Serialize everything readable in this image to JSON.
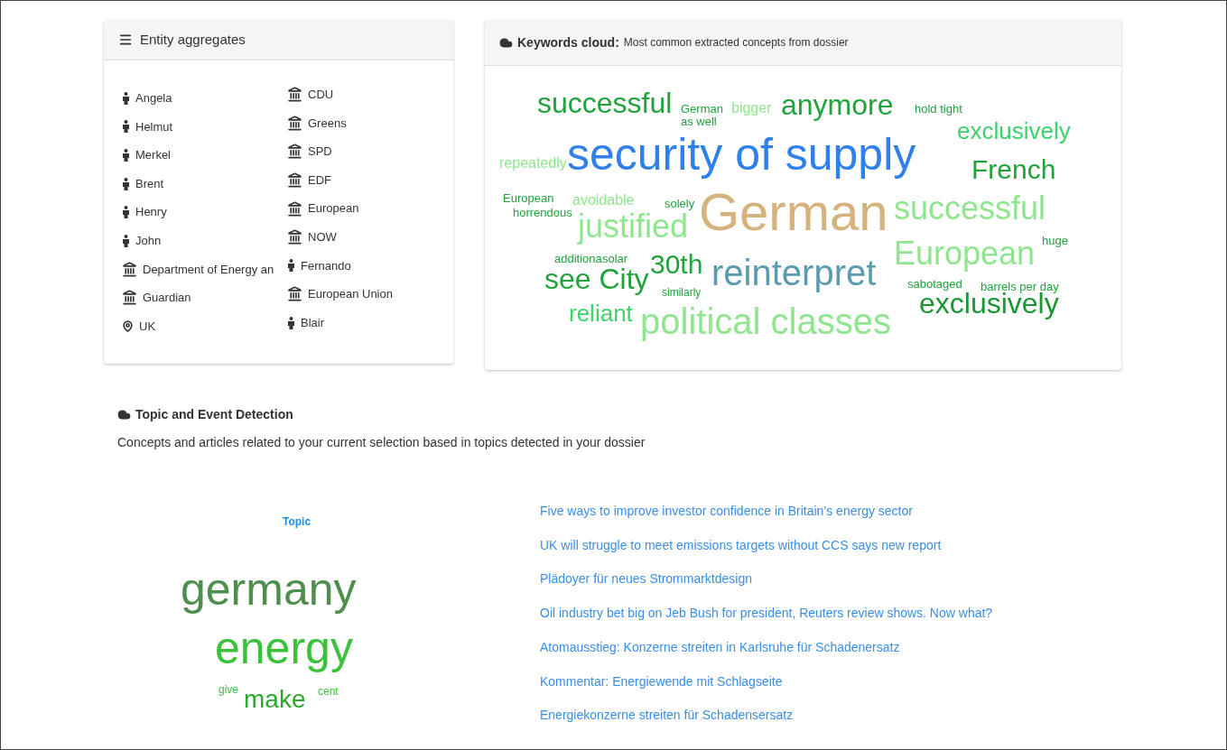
{
  "entity_panel": {
    "title": "Entity aggregates",
    "columns": [
      [
        {
          "kind": "person",
          "name": "Angela"
        },
        {
          "kind": "person",
          "name": "Helmut"
        },
        {
          "kind": "person",
          "name": "Merkel"
        },
        {
          "kind": "person",
          "name": "Brent"
        },
        {
          "kind": "person",
          "name": "Henry"
        },
        {
          "kind": "person",
          "name": "John"
        },
        {
          "kind": "organization",
          "name": "Department of Energy an"
        },
        {
          "kind": "organization",
          "name": "Guardian"
        },
        {
          "kind": "place",
          "name": "UK"
        }
      ],
      [
        {
          "kind": "organization",
          "name": "CDU"
        },
        {
          "kind": "organization",
          "name": "Greens"
        },
        {
          "kind": "organization",
          "name": "SPD"
        },
        {
          "kind": "organization",
          "name": "EDF"
        },
        {
          "kind": "organization",
          "name": "European"
        },
        {
          "kind": "organization",
          "name": "NOW"
        },
        {
          "kind": "person",
          "name": "Fernando"
        },
        {
          "kind": "organization",
          "name": "European Union"
        },
        {
          "kind": "person",
          "name": "Blair"
        }
      ]
    ]
  },
  "keywords_panel": {
    "title": "Keywords cloud:",
    "subtitle": "Most common extracted concepts from dossier",
    "words": [
      {
        "text": "successful",
        "color": "#1fa33a"
      },
      {
        "text": "German",
        "color": "#1fa33a"
      },
      {
        "text": "as well",
        "color": "#1fa33a"
      },
      {
        "text": "bigger",
        "color": "#8fe68f"
      },
      {
        "text": "anymore",
        "color": "#1fa33a"
      },
      {
        "text": "hold tight",
        "color": "#1fa33a"
      },
      {
        "text": "exclusively",
        "color": "#3fd16a"
      },
      {
        "text": "repeatedly",
        "color": "#8fe68f"
      },
      {
        "text": "security of supply",
        "color": "#2f80ed"
      },
      {
        "text": "French",
        "color": "#1fa33a"
      },
      {
        "text": "European",
        "color": "#1fa33a"
      },
      {
        "text": "horrendous",
        "color": "#1fa33a"
      },
      {
        "text": "avoidable",
        "color": "#8fe68f"
      },
      {
        "text": "solely",
        "color": "#1fa33a"
      },
      {
        "text": "German",
        "color": "#d6b27c"
      },
      {
        "text": "successful",
        "color": "#8fe68f"
      },
      {
        "text": "justified",
        "color": "#8fe68f"
      },
      {
        "text": "huge",
        "color": "#1fa33a"
      },
      {
        "text": "additiona",
        "color": "#1fa33a"
      },
      {
        "text": "solar",
        "color": "#1fa33a"
      },
      {
        "text": "30th",
        "color": "#1fa33a"
      },
      {
        "text": "reinterpret",
        "color": "#5b9bb0"
      },
      {
        "text": "European",
        "color": "#8fe68f"
      },
      {
        "text": "see City",
        "color": "#1fa33a"
      },
      {
        "text": "similarly",
        "color": "#1fa33a"
      },
      {
        "text": "sabotaged",
        "color": "#1fa33a"
      },
      {
        "text": "barrels per day",
        "color": "#1fa33a"
      },
      {
        "text": "reliant",
        "color": "#3fd16a"
      },
      {
        "text": "exclusively",
        "color": "#1a9633"
      },
      {
        "text": "political classes",
        "color": "#8fe68f"
      }
    ]
  },
  "topic_section": {
    "title": "Topic and Event Detection",
    "description": "Concepts and articles related to your current selection based in topics detected in your dossier",
    "topic_cloud": {
      "title": "Topic",
      "words": [
        {
          "text": "germany",
          "color": "#4e8f4e"
        },
        {
          "text": "energy",
          "color": "#3cc13c"
        },
        {
          "text": "give",
          "color": "#3cc13c"
        },
        {
          "text": "make",
          "color": "#2ca82c"
        },
        {
          "text": "cent",
          "color": "#3cc13c"
        }
      ]
    },
    "articles": [
      "Five ways to improve investor confidence in Britain’s energy sector",
      "UK will struggle to meet emissions targets without CCS says new report",
      "Plädoyer für neues Strommarktdesign",
      "Oil industry bet big on Jeb Bush for president, Reuters review shows. Now what?",
      "Atomausstieg: Konzerne streiten in Karlsruhe für Schadenersatz",
      "Kommentar: Energiewende mit Schlagseite",
      "Energiekonzerne streiten für Schadensersatz"
    ]
  }
}
